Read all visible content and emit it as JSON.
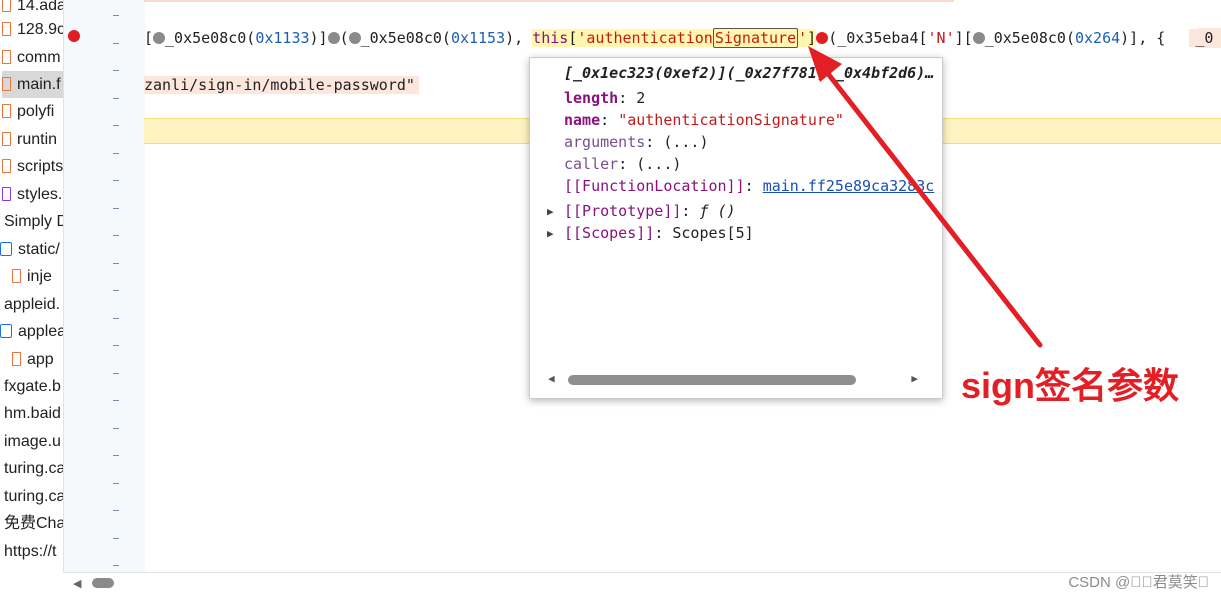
{
  "file_tree": [
    {
      "label": "14.ada",
      "icon": "file-icon",
      "color": "orange"
    },
    {
      "label": "128.9c",
      "icon": "file-icon",
      "color": "orange"
    },
    {
      "label": "comm",
      "icon": "file-icon",
      "color": "orange"
    },
    {
      "label": "main.f",
      "icon": "file-icon",
      "color": "orange",
      "selected": true
    },
    {
      "label": "polyfi",
      "icon": "file-icon",
      "color": "orange"
    },
    {
      "label": "runtin",
      "icon": "file-icon",
      "color": "orange"
    },
    {
      "label": "scripts",
      "icon": "file-icon",
      "color": "orange"
    },
    {
      "label": "styles.",
      "icon": "file-icon",
      "color": "purple"
    },
    {
      "label": "Simply D",
      "icon": "none"
    },
    {
      "label": "static/",
      "icon": "folder-icon"
    },
    {
      "label": "inje",
      "icon": "file-icon",
      "color": "orange"
    },
    {
      "label": "appleid.",
      "icon": "none"
    },
    {
      "label": "applea",
      "icon": "folder-icon"
    },
    {
      "label": "app",
      "icon": "file-icon",
      "color": "orange"
    },
    {
      "label": "fxgate.b",
      "icon": "none"
    },
    {
      "label": "hm.baid",
      "icon": "none"
    },
    {
      "label": "image.u",
      "icon": "none"
    },
    {
      "label": "turing.ca",
      "icon": "none"
    },
    {
      "label": "turing.ca",
      "icon": "none"
    },
    {
      "label": "免费Cha",
      "icon": "none"
    },
    {
      "label": "https://t",
      "icon": "none"
    }
  ],
  "gutter": {
    "dash": "-",
    "breakpoint_color": "#e02020"
  },
  "code": {
    "line1": {
      "p1": "[",
      "p2": "_0x5e08c0(",
      "n1": "0x1133",
      "p3": ")]",
      "p4": "(",
      "p5": "_0x5e08c0(",
      "n2": "0x1153",
      "p6": "), ",
      "kw": "this",
      "b1": "[",
      "s1": "'authentication",
      "s2": "Signature",
      "s3": "'",
      "b2": "]",
      "p7": "(_0x35eba4[",
      "s4": "'N'",
      "p8": "][",
      "p9": "_0x5e08c0(",
      "n3": "0x264",
      "p10": ")], {",
      "tail": "_0"
    },
    "line2": "zanli/sign-in/mobile-password\""
  },
  "popover": {
    "title": "[_0x1ec323(0xef2)](_0x27f781, _0x4bf2d6)…",
    "props": [
      {
        "key": "length",
        "sep": ": ",
        "value": "2",
        "kind": "plain"
      },
      {
        "key": "name",
        "sep": ": ",
        "value": "\"authenticationSignature\"",
        "kind": "string"
      },
      {
        "key": "arguments",
        "sep": ": ",
        "value": "(...)",
        "kind": "dim"
      },
      {
        "key": "caller",
        "sep": ": ",
        "value": "(...)",
        "kind": "dim"
      },
      {
        "key": "[[FunctionLocation]]",
        "sep": ": ",
        "value": "main.ff25e89ca3283c",
        "kind": "link"
      },
      {
        "key": "[[Prototype]]",
        "sep": ": ",
        "value": "ƒ ()",
        "kind": "expandable"
      },
      {
        "key": "[[Scopes]]",
        "sep": ": ",
        "value": "Scopes[5]",
        "kind": "expandable"
      }
    ]
  },
  "annotation": {
    "text": "sign签名参数",
    "color": "#e31e24"
  },
  "watermark": "CSDN @\u0000\u0000君莫笑\u0000"
}
